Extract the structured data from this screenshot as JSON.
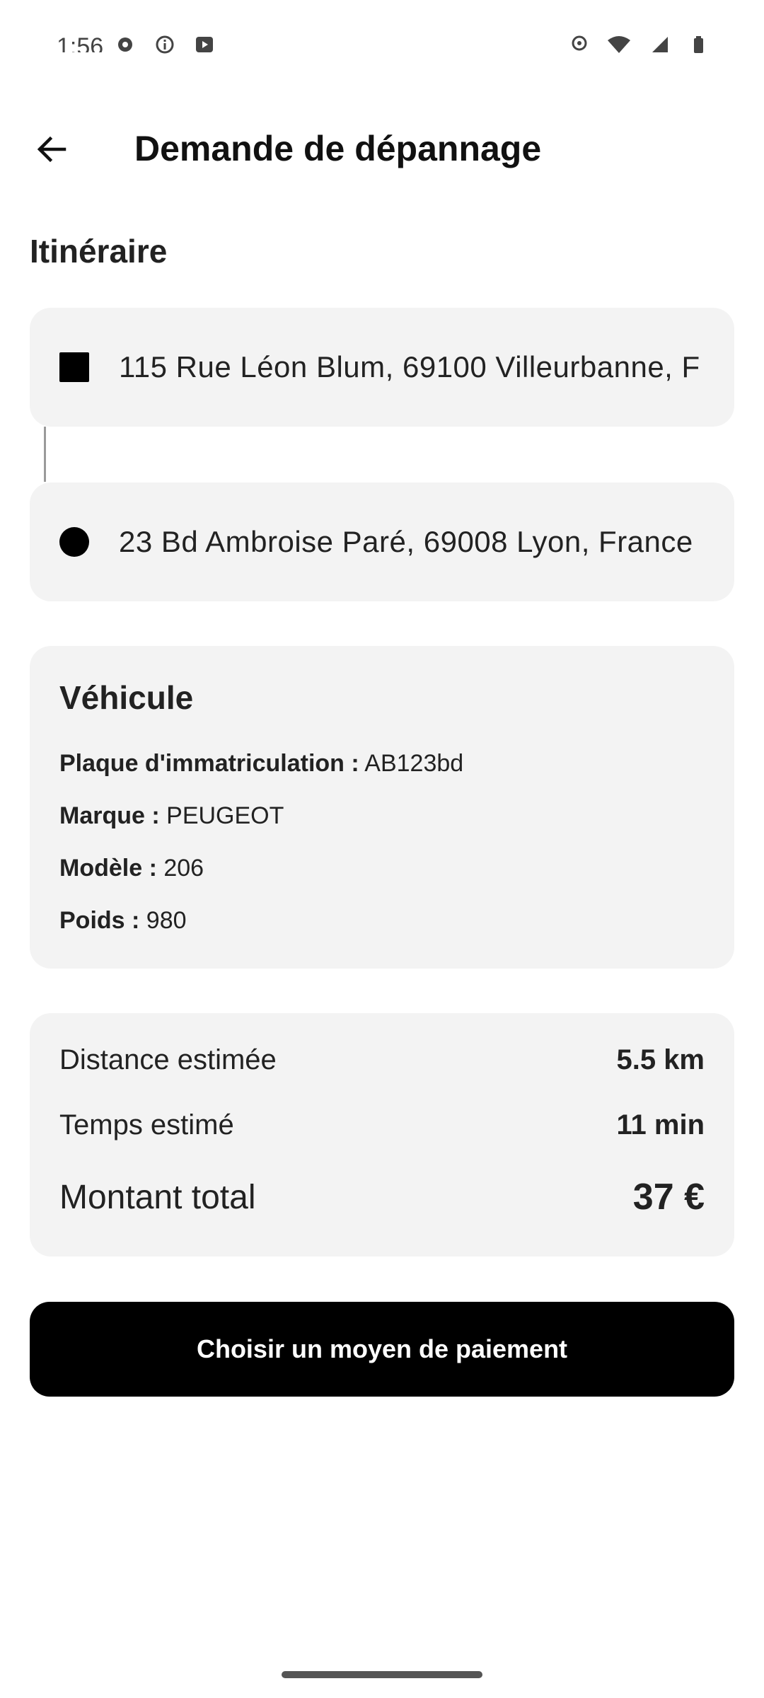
{
  "status_bar": {
    "time": "1:56",
    "left_icons": [
      "settings-icon",
      "info-icon",
      "media-icon"
    ],
    "right_icons": [
      "location-icon",
      "wifi-icon",
      "signal-icon",
      "battery-icon"
    ]
  },
  "app_bar": {
    "back_icon": "arrow-left-icon",
    "title": "Demande de dépannage"
  },
  "itinerary": {
    "title": "Itinéraire",
    "origin": "115 Rue Léon Blum, 69100 Villeurbanne, F",
    "destination": "23 Bd Ambroise Paré, 69008 Lyon, France"
  },
  "vehicle": {
    "title": "Véhicule",
    "rows": [
      {
        "label": "Plaque d'immatriculation :",
        "value": "AB123bd"
      },
      {
        "label": "Marque :",
        "value": "PEUGEOT"
      },
      {
        "label": "Modèle :",
        "value": "206"
      },
      {
        "label": "Poids :",
        "value": "980"
      }
    ]
  },
  "summary": {
    "distance_label": "Distance estimée",
    "distance_value": "5.5 km",
    "time_label": "Temps estimé",
    "time_value": "11 min",
    "total_label": "Montant total",
    "total_value": "37 €"
  },
  "actions": {
    "pay_button": "Choisir un moyen de paiement"
  },
  "colors": {
    "card_background": "#f3f3f3",
    "primary_button": "#000000",
    "button_text": "#ffffff"
  }
}
